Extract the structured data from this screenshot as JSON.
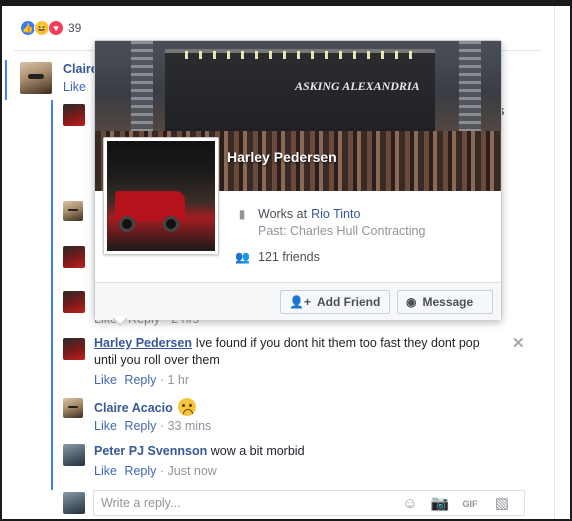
{
  "reactions": {
    "count": "39",
    "types": [
      "like-icon",
      "haha-icon",
      "love-icon"
    ],
    "colors": {
      "like": "#3b7df0",
      "haha": "#f7c640",
      "love": "#f0405c"
    }
  },
  "top_comment": {
    "author": "Claire",
    "action": "Like"
  },
  "hover_card": {
    "name": "Harley Pedersen",
    "works_prefix": "Works at",
    "works_company": "Rio Tinto",
    "past": "Past: Charles Hull Contracting",
    "friends": "121 friends",
    "stage_sign": "ASKING ALEXANDRIA",
    "add_friend_label": "Add Friend",
    "message_label": "Message"
  },
  "hidden_fragments": {
    "right_edge_char": "s",
    "partial_meta": "Like · Reply · 2 hrs"
  },
  "replies": [
    {
      "author": "Harley Pedersen",
      "text_line1": "Ive found if you dont hit them too fast they dont pop",
      "text_line2": "until you roll over them",
      "like": "Like",
      "reply": "Reply",
      "time": "1 hr"
    },
    {
      "author": "Claire Acacio",
      "text_line1": "",
      "emoji": "sad-face-icon",
      "like": "Like",
      "reply": "Reply",
      "time": "33 mins"
    },
    {
      "author": "Peter PJ Svennson",
      "text_line1": "wow a bit morbid",
      "like": "Like",
      "reply": "Reply",
      "time": "Just now"
    }
  ],
  "reply_box": {
    "placeholder": "Write a reply..."
  },
  "colors": {
    "link": "#365899",
    "meta": "#90949c",
    "thread": "#4080ff",
    "accent": "#4267b2"
  }
}
